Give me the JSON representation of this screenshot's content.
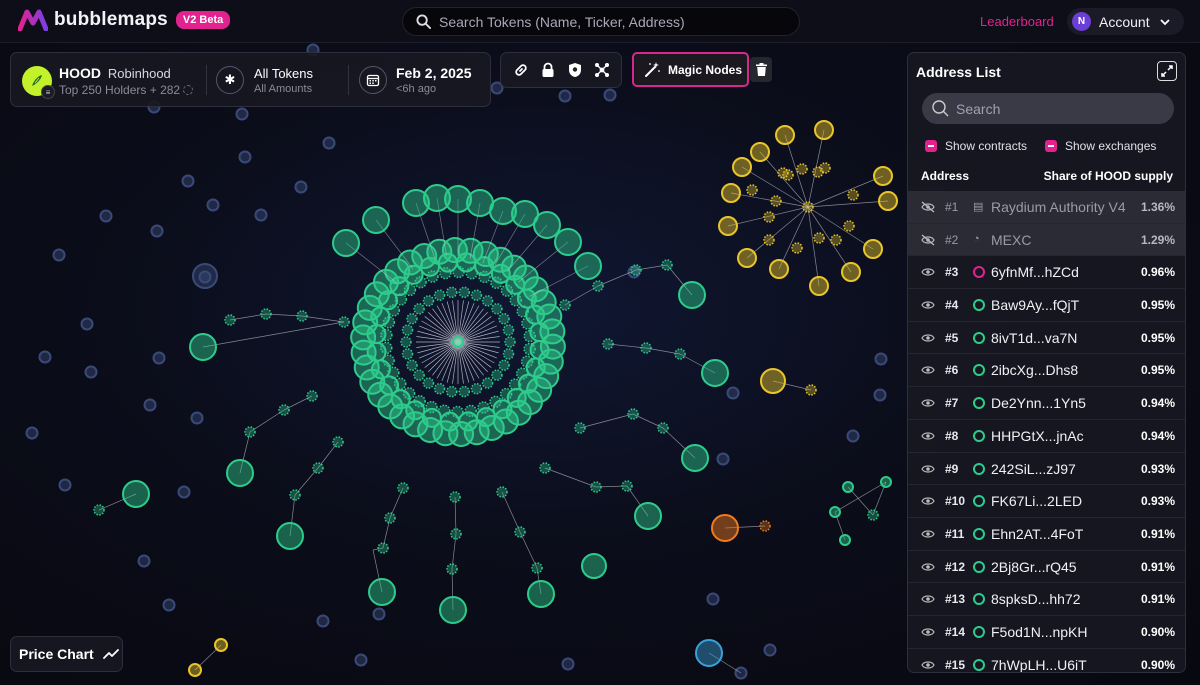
{
  "brand": {
    "name": "bubblemaps",
    "badge": "V2 Beta",
    "accent": "#e3228f"
  },
  "top_search": {
    "placeholder": "Search Tokens (Name, Ticker, Address)"
  },
  "nav": {
    "leaderboard": "Leaderboard",
    "account_initial": "N",
    "account_label": "Account"
  },
  "token": {
    "ticker": "HOOD",
    "name": "Robinhood",
    "holders": "Top 250 Holders + 282",
    "filter_label": "All Tokens",
    "filter_sub": "All Amounts",
    "date": "Feb 2, 2025",
    "date_sub": "<6h ago"
  },
  "toolbar": {
    "icons": [
      "link-icon",
      "lock-icon",
      "shield-icon",
      "network-icon"
    ],
    "magic_nodes": "Magic Nodes",
    "delete_icon": "trash-icon"
  },
  "address_list": {
    "title": "Address List",
    "search_placeholder": "Search",
    "show_contracts": "Show contracts",
    "show_exchanges": "Show exchanges",
    "col_address": "Address",
    "col_share": "Share of HOOD supply",
    "rows": [
      {
        "rank": "#1",
        "address": "Raydium Authority V4",
        "share": "1.36%",
        "kind": "contract",
        "hidden": true
      },
      {
        "rank": "#2",
        "address": "MEXC",
        "share": "1.29%",
        "kind": "exchange",
        "hidden": true
      },
      {
        "rank": "#3",
        "address": "6yfnMf...hZCd",
        "share": "0.96%",
        "kind": "wallet",
        "hidden": false,
        "color": "#e3228f"
      },
      {
        "rank": "#4",
        "address": "Baw9Ay...fQjT",
        "share": "0.95%",
        "kind": "wallet",
        "hidden": false,
        "color": "#2ecc8c"
      },
      {
        "rank": "#5",
        "address": "8ivT1d...va7N",
        "share": "0.95%",
        "kind": "wallet",
        "hidden": false,
        "color": "#2ecc8c"
      },
      {
        "rank": "#6",
        "address": "2ibcXg...Dhs8",
        "share": "0.95%",
        "kind": "wallet",
        "hidden": false,
        "color": "#2ecc8c"
      },
      {
        "rank": "#7",
        "address": "De2Ynn...1Yn5",
        "share": "0.94%",
        "kind": "wallet",
        "hidden": false,
        "color": "#2ecc8c"
      },
      {
        "rank": "#8",
        "address": "HHPGtX...jnAc",
        "share": "0.94%",
        "kind": "wallet",
        "hidden": false,
        "color": "#2ecc8c"
      },
      {
        "rank": "#9",
        "address": "242SiL...zJ97",
        "share": "0.93%",
        "kind": "wallet",
        "hidden": false,
        "color": "#2ecc8c"
      },
      {
        "rank": "#10",
        "address": "FK67Li...2LED",
        "share": "0.93%",
        "kind": "wallet",
        "hidden": false,
        "color": "#2ecc8c"
      },
      {
        "rank": "#11",
        "address": "Ehn2AT...4FoT",
        "share": "0.91%",
        "kind": "wallet",
        "hidden": false,
        "color": "#2ecc8c"
      },
      {
        "rank": "#12",
        "address": "2Bj8Gr...rQ45",
        "share": "0.91%",
        "kind": "wallet",
        "hidden": false,
        "color": "#2ecc8c"
      },
      {
        "rank": "#13",
        "address": "8spksD...hh72",
        "share": "0.91%",
        "kind": "wallet",
        "hidden": false,
        "color": "#2ecc8c"
      },
      {
        "rank": "#14",
        "address": "F5od1N...npKH",
        "share": "0.90%",
        "kind": "wallet",
        "hidden": false,
        "color": "#2ecc8c"
      },
      {
        "rank": "#15",
        "address": "7hWpLH...U6iT",
        "share": "0.90%",
        "kind": "wallet",
        "hidden": false,
        "color": "#2ecc8c"
      }
    ]
  },
  "price_chart": {
    "label": "Price Chart"
  },
  "bubble_colors": {
    "green": "#2ecc8c",
    "yellow": "#e8c52a",
    "orange": "#f07a1e",
    "blue": "#3aa0d8",
    "grey": "#3a4a78"
  }
}
